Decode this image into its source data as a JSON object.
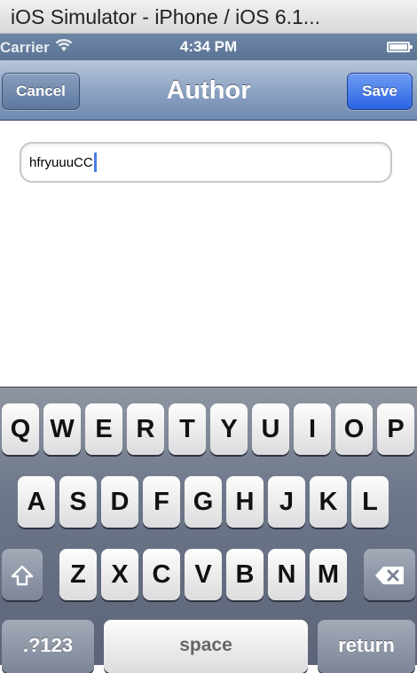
{
  "window": {
    "title": "iOS Simulator - iPhone / iOS 6.1..."
  },
  "status_bar": {
    "carrier": "Carrier",
    "wifi_icon": "wifi-icon",
    "time": "4:34 PM",
    "battery_icon": "battery-icon"
  },
  "nav_bar": {
    "title": "Author",
    "cancel_label": "Cancel",
    "save_label": "Save",
    "save_color": "#2f6ae6",
    "bar_color": "#8ea4c3"
  },
  "form": {
    "author_value": "hfryuuuCC"
  },
  "keyboard": {
    "row1": [
      "Q",
      "W",
      "E",
      "R",
      "T",
      "Y",
      "U",
      "I",
      "O",
      "P"
    ],
    "row2": [
      "A",
      "S",
      "D",
      "F",
      "G",
      "H",
      "J",
      "K",
      "L"
    ],
    "row3": [
      "Z",
      "X",
      "C",
      "V",
      "B",
      "N",
      "M"
    ],
    "shift_icon": "shift-icon",
    "delete_icon": "delete-icon",
    "numbers_label": ".?123",
    "space_label": "space",
    "return_label": "return"
  }
}
